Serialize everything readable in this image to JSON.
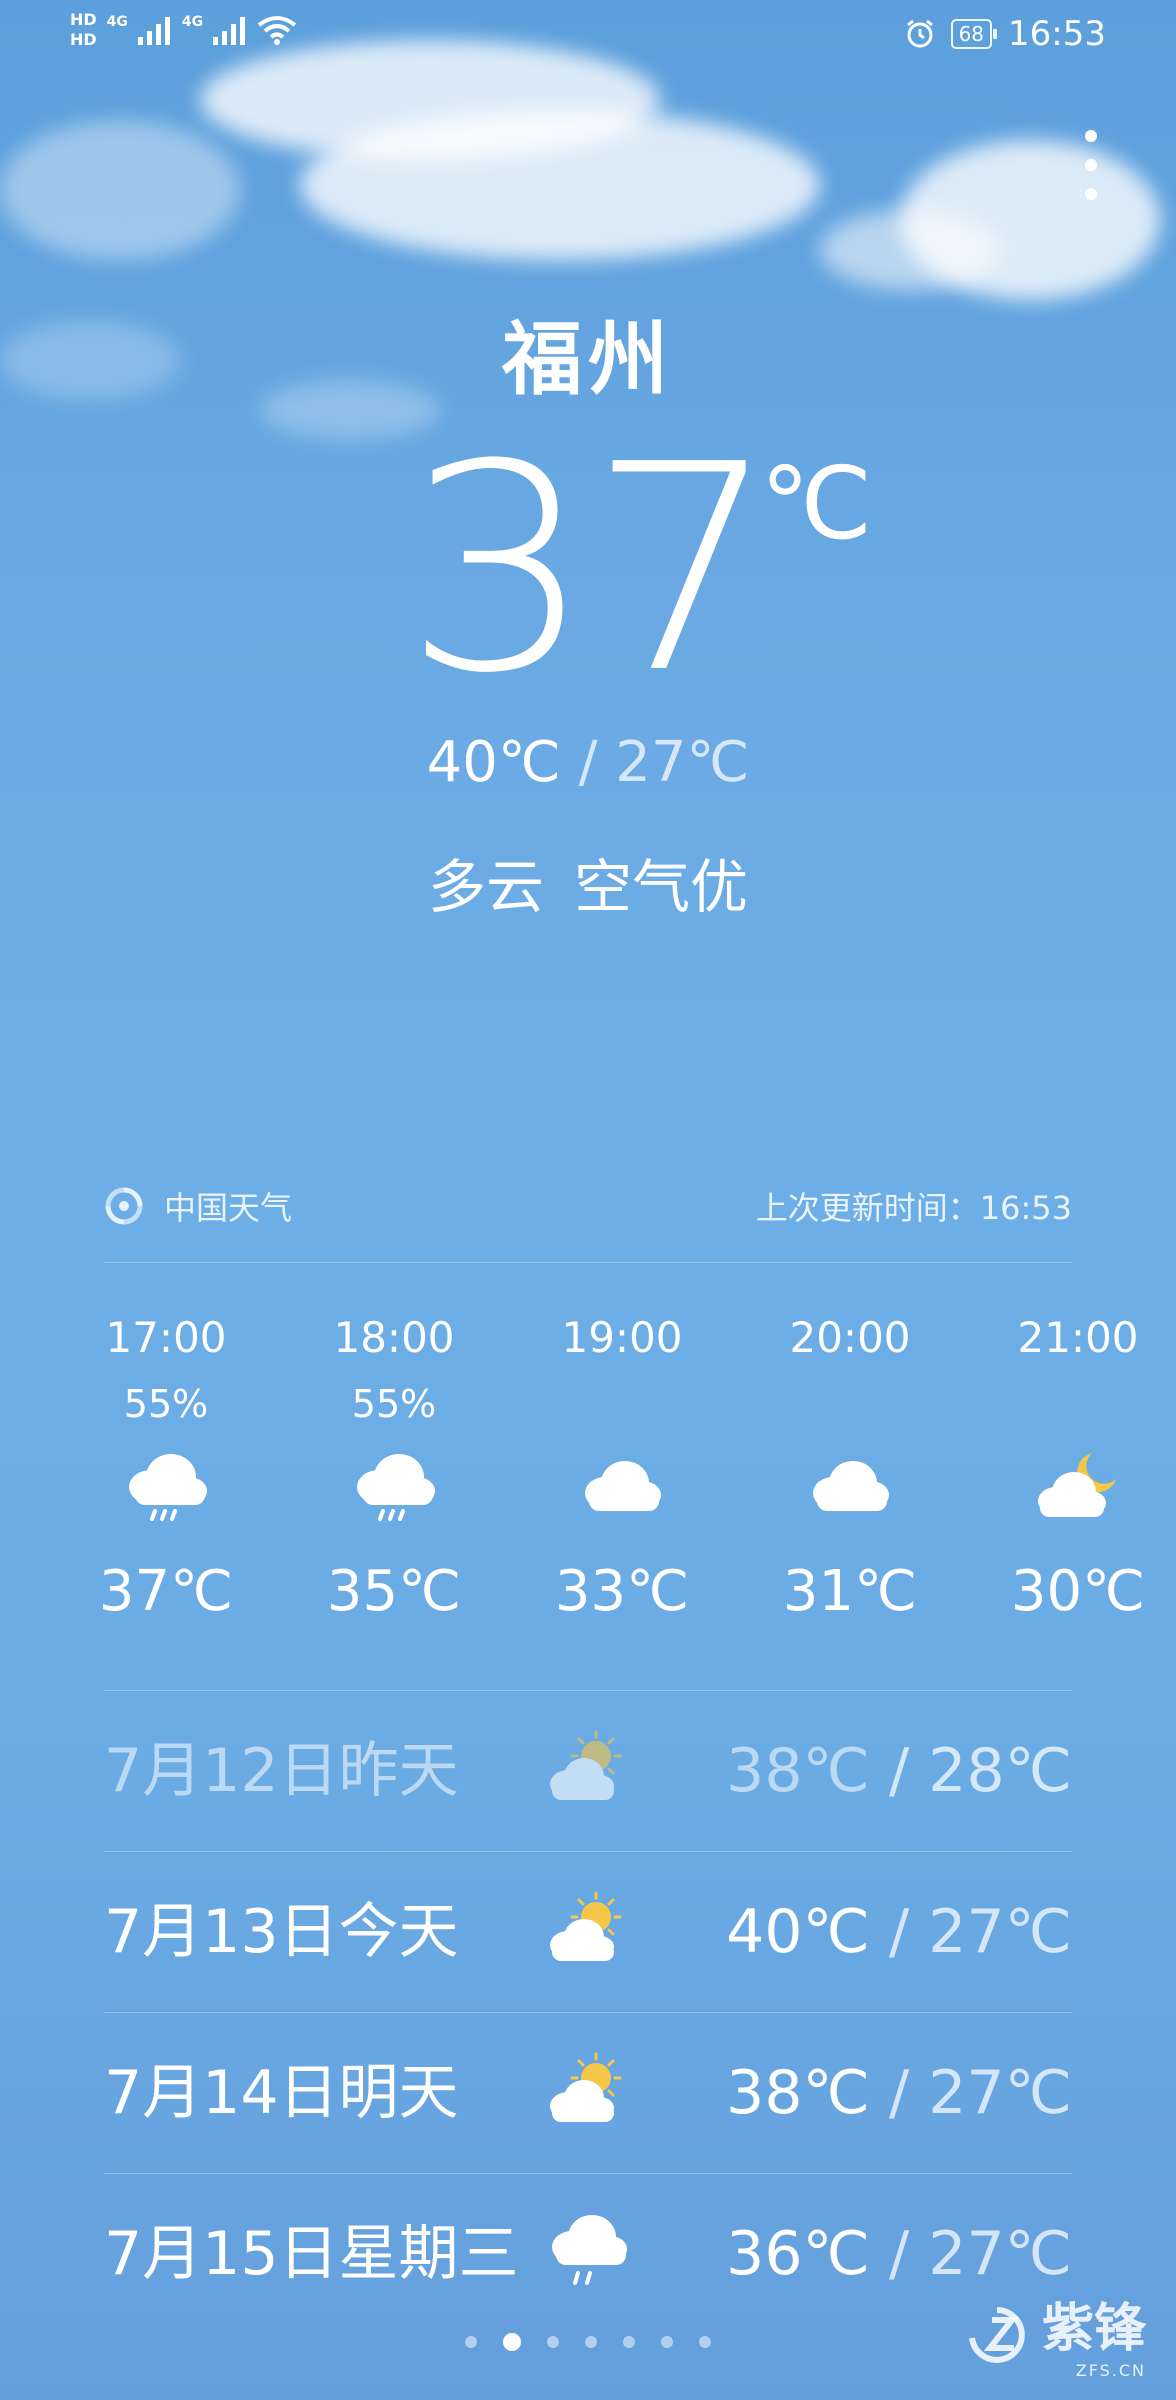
{
  "status_bar": {
    "hd1": "HD",
    "hd2": "HD",
    "net1": "4G",
    "net2": "4G",
    "battery": "68",
    "time": "16:53"
  },
  "hero": {
    "city": "福州",
    "current_temp": "37",
    "unit": "℃",
    "high": "40℃",
    "separator": "/",
    "low": "27℃",
    "condition": "多云",
    "air_quality": "空气优"
  },
  "source": {
    "provider": "中国天气",
    "updated_label": "上次更新时间：16:53"
  },
  "hourly": [
    {
      "time": "17:00",
      "precip": "55%",
      "icon": "rain-cloud-icon",
      "temp": "37℃"
    },
    {
      "time": "18:00",
      "precip": "55%",
      "icon": "rain-cloud-icon",
      "temp": "35℃"
    },
    {
      "time": "19:00",
      "precip": "",
      "icon": "cloud-icon",
      "temp": "33℃"
    },
    {
      "time": "20:00",
      "precip": "",
      "icon": "cloud-icon",
      "temp": "31℃"
    },
    {
      "time": "21:00",
      "precip": "",
      "icon": "moon-cloud-icon",
      "temp": "30℃"
    }
  ],
  "daily": [
    {
      "date": "7月12日昨天",
      "icon": "partly-cloudy-icon",
      "high": "38℃",
      "separator": "/",
      "low": "28℃",
      "past": true
    },
    {
      "date": "7月13日今天",
      "icon": "partly-cloudy-icon",
      "high": "40℃",
      "separator": "/",
      "low": "27℃",
      "past": false
    },
    {
      "date": "7月14日明天",
      "icon": "partly-cloudy-icon",
      "high": "38℃",
      "separator": "/",
      "low": "27℃",
      "past": false
    },
    {
      "date": "7月15日星期三",
      "icon": "rain-cloud-icon",
      "high": "36℃",
      "separator": "/",
      "low": "27℃",
      "past": false
    }
  ],
  "pagination": {
    "count": 7,
    "active_index": 1
  },
  "watermark": {
    "text": "紫锋",
    "sub": "ZFS.CN"
  }
}
